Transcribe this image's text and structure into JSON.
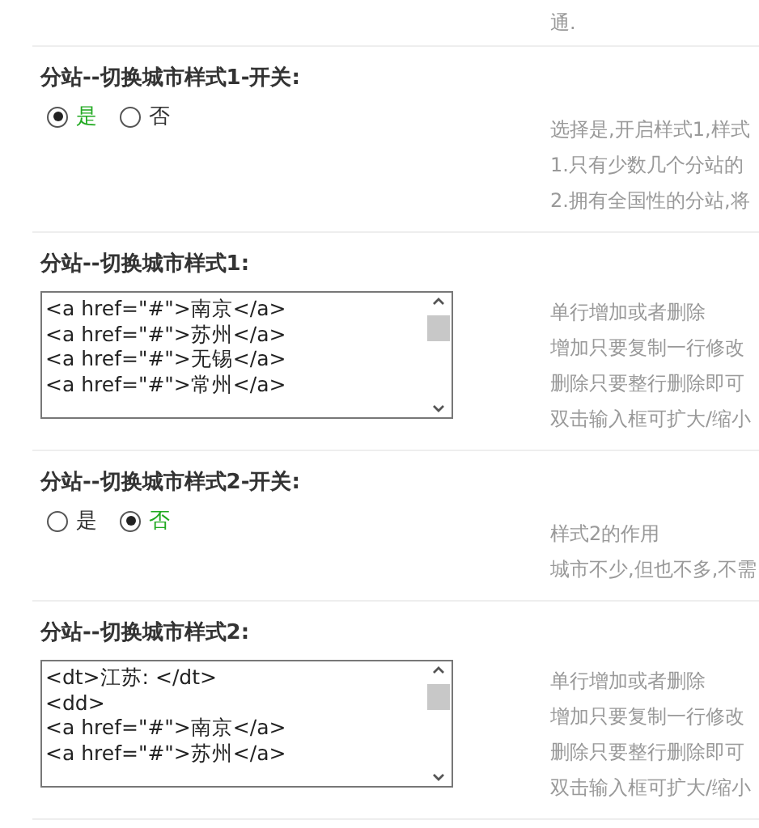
{
  "top_note": "通.",
  "sections": [
    {
      "kind": "radio",
      "title": "分站--切换城市样式1-开关:",
      "options": [
        {
          "label": "是",
          "selected": true
        },
        {
          "label": "否",
          "selected": false
        }
      ],
      "notes": [
        "选择是,开启样式1,样式",
        "1.只有少数几个分站的",
        "2.拥有全国性的分站,将"
      ]
    },
    {
      "kind": "code",
      "title": "分站--切换城市样式1:",
      "lines": [
        "<a href=\"#\">南京</a>",
        "<a href=\"#\">苏州</a>",
        "<a href=\"#\">无锡</a>",
        "<a href=\"#\">常州</a>"
      ],
      "notes": [
        "单行增加或者删除",
        "增加只要复制一行修改",
        "删除只要整行删除即可",
        "双击输入框可扩大/缩小"
      ]
    },
    {
      "kind": "radio",
      "title": "分站--切换城市样式2-开关:",
      "options": [
        {
          "label": "是",
          "selected": false
        },
        {
          "label": "否",
          "selected": true
        }
      ],
      "notes": [
        "样式2的作用",
        "城市不少,但也不多,不需"
      ]
    },
    {
      "kind": "code",
      "title": "分站--切换城市样式2:",
      "lines": [
        "<dt>江苏: </dt>",
        "<dd>",
        "<a href=\"#\">南京</a>",
        "<a href=\"#\">苏州</a>"
      ],
      "notes": [
        "单行增加或者删除",
        "增加只要复制一行修改",
        "删除只要整行删除即可",
        "双击输入框可扩大/缩小"
      ]
    }
  ]
}
